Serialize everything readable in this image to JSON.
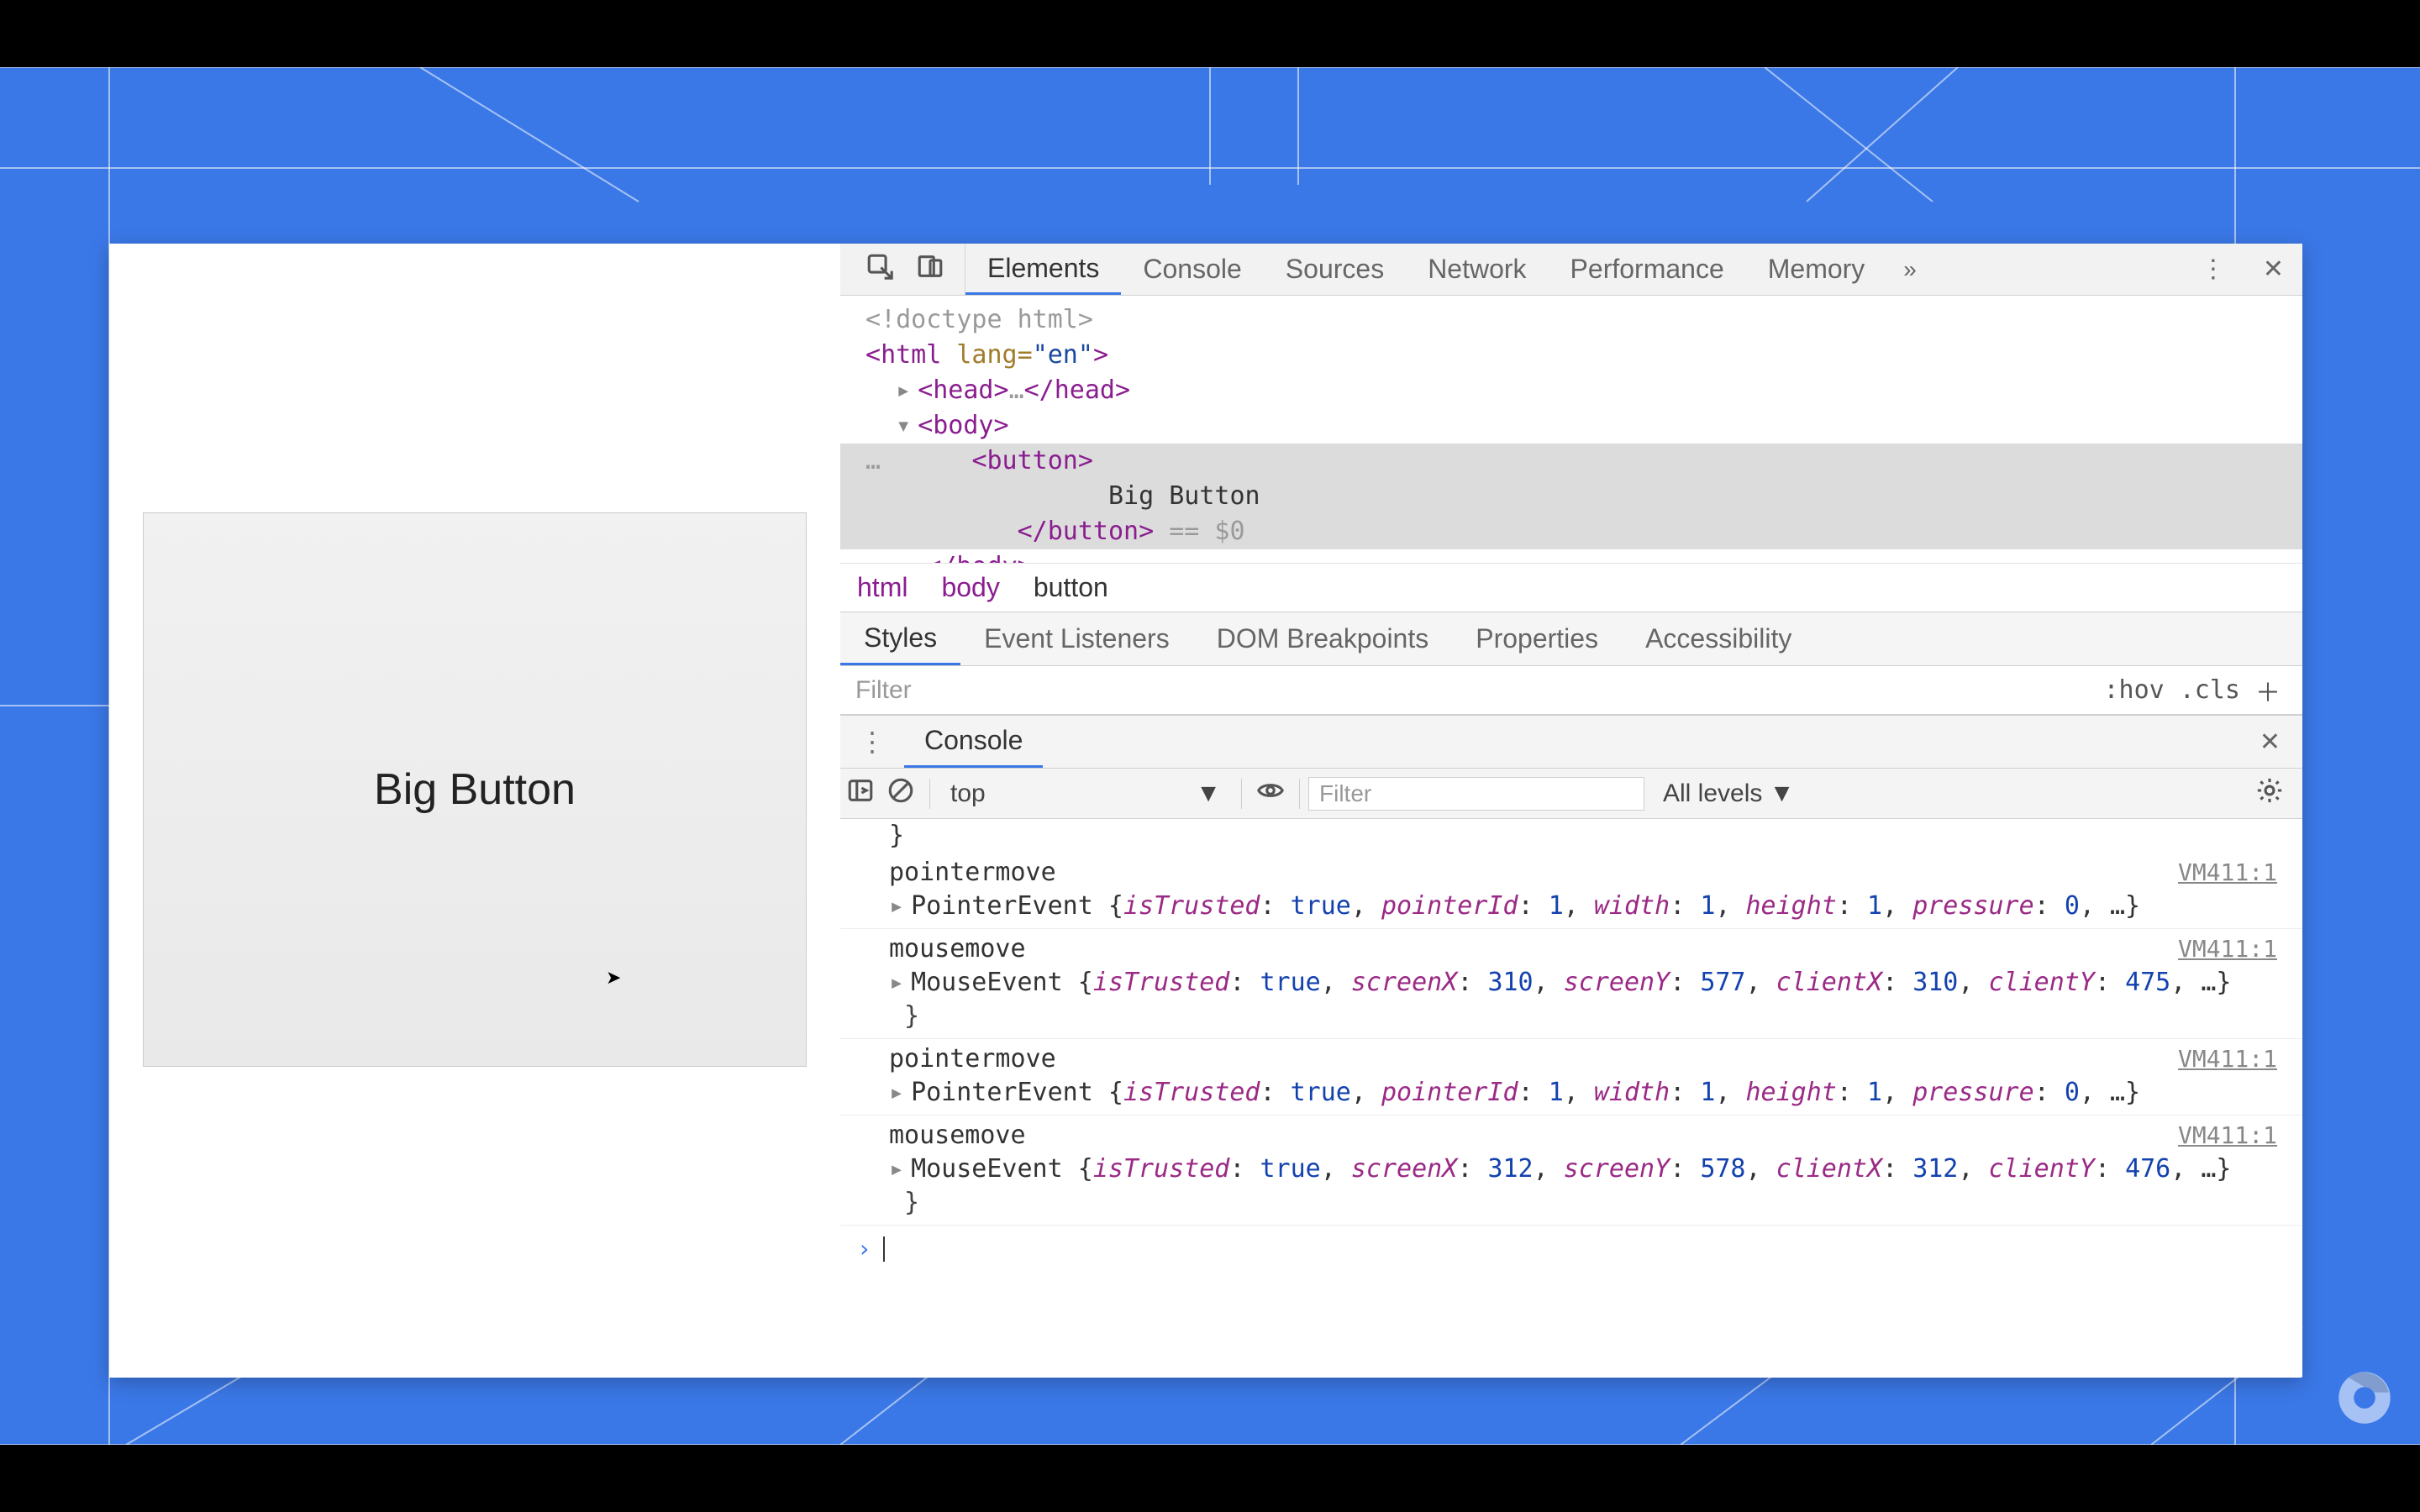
{
  "page": {
    "button_label": "Big Button"
  },
  "tabs": {
    "items": [
      "Elements",
      "Console",
      "Sources",
      "Network",
      "Performance",
      "Memory"
    ],
    "active": "Elements"
  },
  "dom": {
    "l0": "<!doctype html>",
    "l1_open": "<",
    "l1_tag": "html",
    "l1_attr": " lang=",
    "l1_val": "\"en\"",
    "l1_close": ">",
    "l2_head": "<head>…</head>",
    "l3_body_open": "<body>",
    "l4_sel_open": "<button>",
    "l4_text": "Big Button",
    "l4_sel_close": "</button>",
    "l4_eq": " == $0",
    "l5_body_close": "</body>",
    "sel_dots": "…"
  },
  "breadcrumb": [
    "html",
    "body",
    "button"
  ],
  "subtabs": [
    "Styles",
    "Event Listeners",
    "DOM Breakpoints",
    "Properties",
    "Accessibility"
  ],
  "styles": {
    "filter_placeholder": "Filter",
    "hov": ":hov",
    "cls": ".cls"
  },
  "drawer": {
    "tab": "Console"
  },
  "console": {
    "context": "top",
    "filter_placeholder": "Filter",
    "levels": "All levels ▼",
    "entries": [
      {
        "type": "close-brace"
      },
      {
        "name": "pointermove",
        "klass": "PointerEvent",
        "src": "VM411:1",
        "props": "{isTrusted: true, pointerId: 1, width: 1, height: 1, pressure: 0, …}"
      },
      {
        "name": "mousemove",
        "klass": "MouseEvent",
        "src": "VM411:1",
        "props": "{isTrusted: true, screenX: 310, screenY: 577, clientX: 310, clientY: 475, …}",
        "trailing_brace": true
      },
      {
        "name": "pointermove",
        "klass": "PointerEvent",
        "src": "VM411:1",
        "props": "{isTrusted: true, pointerId: 1, width: 1, height: 1, pressure: 0, …}"
      },
      {
        "name": "mousemove",
        "klass": "MouseEvent",
        "src": "VM411:1",
        "props": "{isTrusted: true, screenX: 312, screenY: 578, clientX: 312, clientY: 476, …}",
        "trailing_brace": true
      }
    ]
  }
}
